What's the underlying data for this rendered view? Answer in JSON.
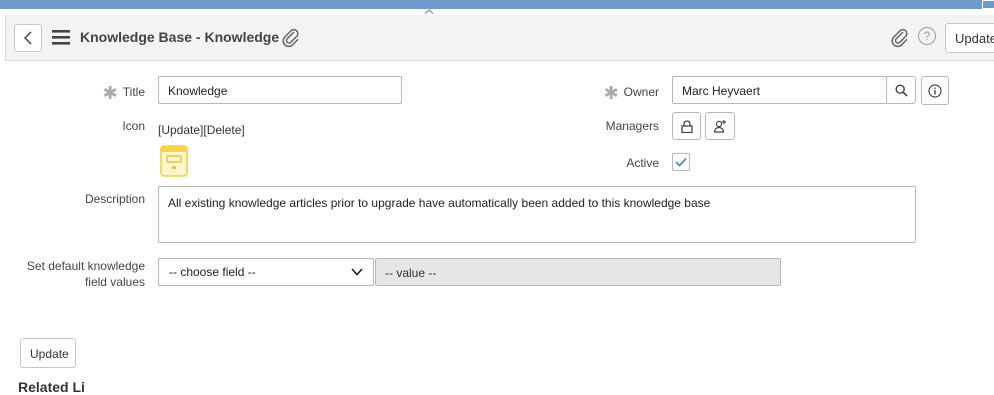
{
  "header": {
    "title": "Knowledge Base - Knowledge",
    "update_label": "Update",
    "help_label": "?"
  },
  "form": {
    "title_label": "Title",
    "title_value": "Knowledge",
    "owner_label": "Owner",
    "owner_value": "Marc Heyvaert",
    "icon_label": "Icon",
    "icon_links": "[Update][Delete]",
    "managers_label": "Managers",
    "active_label": "Active",
    "active_checked": true,
    "description_label": "Description",
    "description_value": "All existing knowledge articles prior to upgrade have automatically been added to this knowledge base",
    "defaults_label_line1": "Set default knowledge",
    "defaults_label_line2": "field values",
    "choose_field": "-- choose field --",
    "value_placeholder": "-- value --",
    "required_marker": "✱"
  },
  "footer": {
    "update_label": "Update",
    "related_links_partial": "Related Li"
  },
  "colors": {
    "topbar": "#6d9bcc",
    "header_bg": "#f3f3f3",
    "kb_icon": "#f5d547",
    "checkmark": "#3c78b4"
  }
}
